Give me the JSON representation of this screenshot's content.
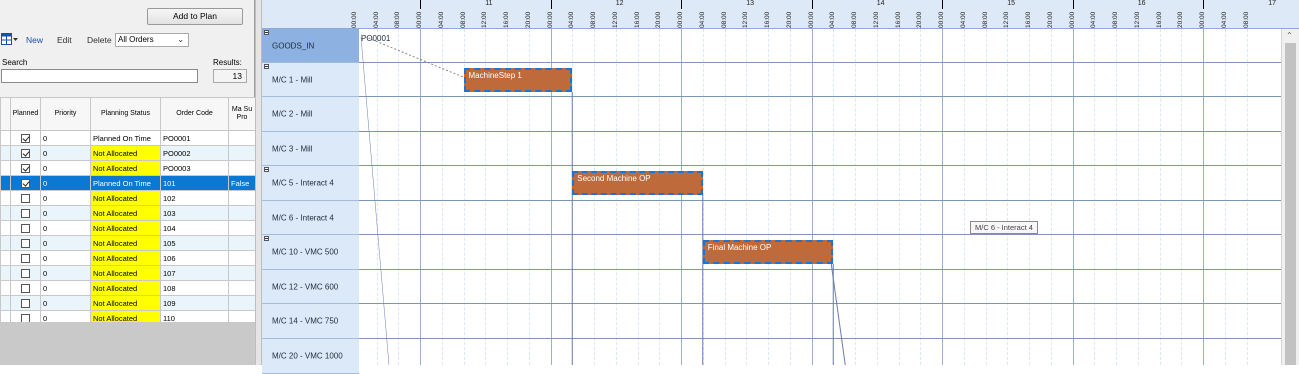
{
  "left_panel": {
    "add_to_plan_label": "Add to Plan",
    "toolbar": {
      "new_label": "New",
      "edit_label": "Edit",
      "delete_label": "Delete",
      "orders_filter_value": "All Orders"
    },
    "search_label": "Search",
    "search_value": "",
    "results_label": "Results:",
    "results_count": "13",
    "table": {
      "columns": [
        "",
        "Planned",
        "Priority",
        "Planning Status",
        "Order Code",
        "Ma Su Pro"
      ],
      "rows": [
        {
          "planned": true,
          "priority": "0",
          "status": "Planned On Time",
          "status_color": "none",
          "order_code": "PO0001",
          "extra": ""
        },
        {
          "planned": true,
          "priority": "0",
          "status": "Not Allocated",
          "status_color": "yellow",
          "order_code": "PO0002",
          "extra": ""
        },
        {
          "planned": true,
          "priority": "0",
          "status": "Not Allocated",
          "status_color": "yellow",
          "order_code": "PO0003",
          "extra": ""
        },
        {
          "planned": true,
          "priority": "0",
          "status": "Planned On Time",
          "status_color": "none",
          "order_code": "101",
          "extra": "False"
        },
        {
          "planned": false,
          "priority": "0",
          "status": "Not Allocated",
          "status_color": "yellow",
          "order_code": "102",
          "extra": ""
        },
        {
          "planned": false,
          "priority": "0",
          "status": "Not Allocated",
          "status_color": "yellow",
          "order_code": "103",
          "extra": ""
        },
        {
          "planned": false,
          "priority": "0",
          "status": "Not Allocated",
          "status_color": "yellow",
          "order_code": "104",
          "extra": ""
        },
        {
          "planned": false,
          "priority": "0",
          "status": "Not Allocated",
          "status_color": "yellow",
          "order_code": "105",
          "extra": ""
        },
        {
          "planned": false,
          "priority": "0",
          "status": "Not Allocated",
          "status_color": "yellow",
          "order_code": "106",
          "extra": ""
        },
        {
          "planned": false,
          "priority": "0",
          "status": "Not Allocated",
          "status_color": "yellow",
          "order_code": "107",
          "extra": ""
        },
        {
          "planned": false,
          "priority": "0",
          "status": "Not Allocated",
          "status_color": "yellow",
          "order_code": "108",
          "extra": ""
        },
        {
          "planned": false,
          "priority": "0",
          "status": "Not Allocated",
          "status_color": "yellow",
          "order_code": "109",
          "extra": ""
        },
        {
          "planned": false,
          "priority": "0",
          "status": "Not Allocated",
          "status_color": "yellow",
          "order_code": "110",
          "extra": ""
        }
      ],
      "selected_row_index": 3
    }
  },
  "gantt": {
    "days": [
      "11",
      "12",
      "13",
      "14",
      "15",
      "16",
      "17"
    ],
    "hours": [
      "00:00",
      "04:00",
      "08:00",
      "12:00",
      "16:00",
      "20:00"
    ],
    "leading_hours": [
      "00:00",
      "04:00",
      "08:00"
    ],
    "resources": [
      {
        "label": "GOODS_IN",
        "expandable": true,
        "highlight": true
      },
      {
        "label": "M/C 1 - Mill",
        "expandable": true,
        "highlight": false
      },
      {
        "label": "M/C 2 - Mill",
        "expandable": false,
        "highlight": false
      },
      {
        "label": "M/C 3 - Mill",
        "expandable": false,
        "highlight": false
      },
      {
        "label": "M/C 5 - Interact 4",
        "expandable": true,
        "highlight": false
      },
      {
        "label": "M/C 6 - Interact 4",
        "expandable": false,
        "highlight": false
      },
      {
        "label": "M/C 10 - VMC 500",
        "expandable": true,
        "highlight": false
      },
      {
        "label": "M/C 12 - VMC 600",
        "expandable": false,
        "highlight": false
      },
      {
        "label": "M/C 14 - VMC 750",
        "expandable": false,
        "highlight": false
      },
      {
        "label": "M/C 20 - VMC 1000",
        "expandable": false,
        "highlight": false
      }
    ],
    "goods_in_order": "PO0001",
    "tasks": [
      {
        "label": "MachineStep 1",
        "resource_index": 1,
        "start": "11 08:00",
        "end": "12 04:00"
      },
      {
        "label": "Second Machine OP",
        "resource_index": 4,
        "start": "12 04:00",
        "end": "13 04:00"
      },
      {
        "label": "Final Machine OP",
        "resource_index": 6,
        "start": "13 04:00",
        "end": "14 04:00"
      }
    ],
    "tooltip": "M/C 6 - Interact 4",
    "colors": {
      "task_fill": "#bf6a3a",
      "task_border": "#1a74d4",
      "header_bg": "#dde9f7",
      "selected_row": "#0b78d4",
      "not_allocated": "#ffff00"
    }
  }
}
